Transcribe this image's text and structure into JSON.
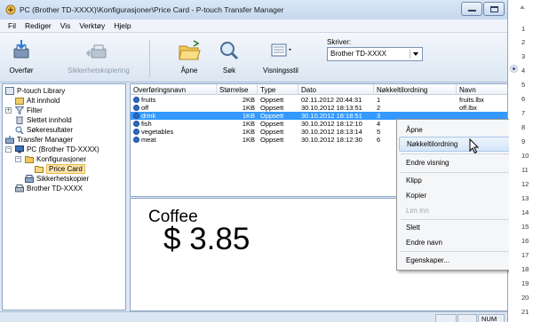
{
  "window": {
    "title": "PC (Brother TD-XXXX)\\Konfigurasjoner\\Price Card - P-touch Transfer Manager"
  },
  "menu": [
    "Fil",
    "Rediger",
    "Vis",
    "Verktøy",
    "Hjelp"
  ],
  "toolbar": {
    "transfer_label": "Overfør",
    "backup_label": "Sikkerhetskopiering",
    "open_label": "Åpne",
    "search_label": "Søk",
    "view_style_label": "Visningsstil",
    "printer_label": "Skriver:",
    "printer_value": "Brother TD-XXXX"
  },
  "tree": {
    "items": [
      {
        "label": "P-touch Library"
      },
      {
        "label": "Alt innhold"
      },
      {
        "label": "Filter"
      },
      {
        "label": "Slettet innhold"
      },
      {
        "label": "Søkeresultater"
      },
      {
        "label": "Transfer Manager"
      },
      {
        "label": "PC (Brother TD-XXXX)"
      },
      {
        "label": "Konfigurasjoner"
      },
      {
        "label": "Price Card"
      },
      {
        "label": "Sikkerhetskopier"
      },
      {
        "label": "Brother TD-XXXX"
      }
    ]
  },
  "list": {
    "columns": [
      "Overføringsnavn",
      "Størrelse",
      "Type",
      "Dato",
      "Nøkkeltilordning",
      "Navn"
    ],
    "rows": [
      {
        "name": "fruits",
        "size": "2KB",
        "type": "Oppsett",
        "date": "02.11.2012 20:44:31",
        "key": "1",
        "file": "fruits.lbx"
      },
      {
        "name": "off",
        "size": "1KB",
        "type": "Oppsett",
        "date": "30.10.2012 18:13:51",
        "key": "2",
        "file": "off.lbx"
      },
      {
        "name": "drink",
        "size": "1KB",
        "type": "Oppsett",
        "date": "30.10.2012 18:18:51",
        "key": "3",
        "file": ""
      },
      {
        "name": "fish",
        "size": "1KB",
        "type": "Oppsett",
        "date": "30.10.2012 18:12:10",
        "key": "4",
        "file": ""
      },
      {
        "name": "vegetables",
        "size": "1KB",
        "type": "Oppsett",
        "date": "30.10.2012 18:13:14",
        "key": "5",
        "file": ""
      },
      {
        "name": "meat",
        "size": "1KB",
        "type": "Oppsett",
        "date": "30.10.2012 18:12:30",
        "key": "6",
        "file": ""
      }
    ],
    "selected_row": "drink"
  },
  "preview": {
    "line1": "Coffee",
    "line2": "$ 3.85"
  },
  "context_menu": {
    "items": [
      "Åpne",
      "Nøkkeltilordning",
      "Endre visning",
      "Klipp",
      "Kopier",
      "Lim inn",
      "Slett",
      "Endre navn",
      "Egenskaper..."
    ]
  },
  "status": {
    "num": "NUM"
  },
  "page_strip": {
    "numbers": [
      "1",
      "2",
      "3",
      "4",
      "5",
      "6",
      "7",
      "8",
      "9",
      "10",
      "11",
      "12",
      "13",
      "14",
      "15",
      "16",
      "17",
      "18",
      "19",
      "20",
      "21"
    ],
    "current": "3"
  },
  "colors": {
    "selection": "#3399ff",
    "window_frame": "#dfe9f5",
    "tree_highlight": "#fde5a8"
  }
}
